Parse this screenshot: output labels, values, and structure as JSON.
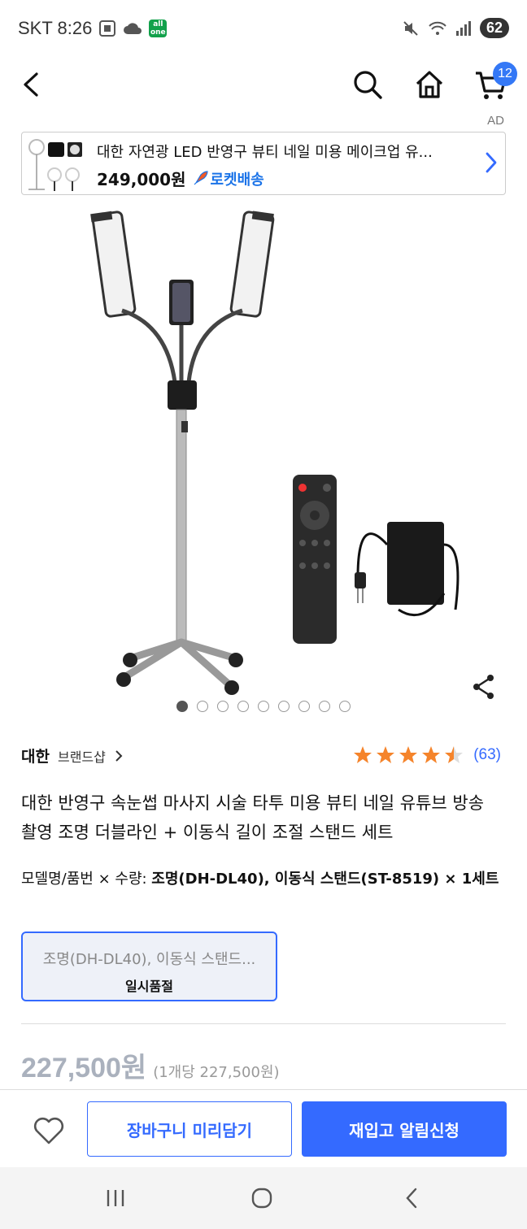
{
  "status_bar": {
    "carrier_time": "SKT 8:26",
    "one_badge": "all one",
    "battery": "62"
  },
  "nav": {
    "cart_count": "12"
  },
  "ad": {
    "label": "AD",
    "title": "대한 자연광 LED 반영구 뷰티 네일 미용 메이크업 유...",
    "price": "249,000원",
    "delivery": "로켓배송"
  },
  "gallery": {
    "total": 9,
    "active": 1
  },
  "brand": {
    "name": "대한",
    "shop_label": "브랜드샵"
  },
  "rating": {
    "stars": 4.5,
    "count": "(63)"
  },
  "product": {
    "title": "대한 반영구 속눈썹 마사지 시술 타투 미용 뷰티 네일 유튜브 방송 촬영 조명 더블라인 + 이동식 길이 조절 스탠드 세트",
    "option_prefix": "모델명/품번 × 수량: ",
    "option_value": "조명(DH-DL40), 이동식 스탠드(ST-8519) × 1세트"
  },
  "option_box": {
    "name": "조명(DH-DL40), 이동식 스탠드...",
    "status": "일시품절"
  },
  "price": {
    "main": "227,500원",
    "unit": "(1개당 227,500원)"
  },
  "actions": {
    "cart": "장바구니 미리담기",
    "restock": "재입고 알림신청"
  },
  "colors": {
    "accent": "#346aff",
    "star": "#f5842b"
  }
}
